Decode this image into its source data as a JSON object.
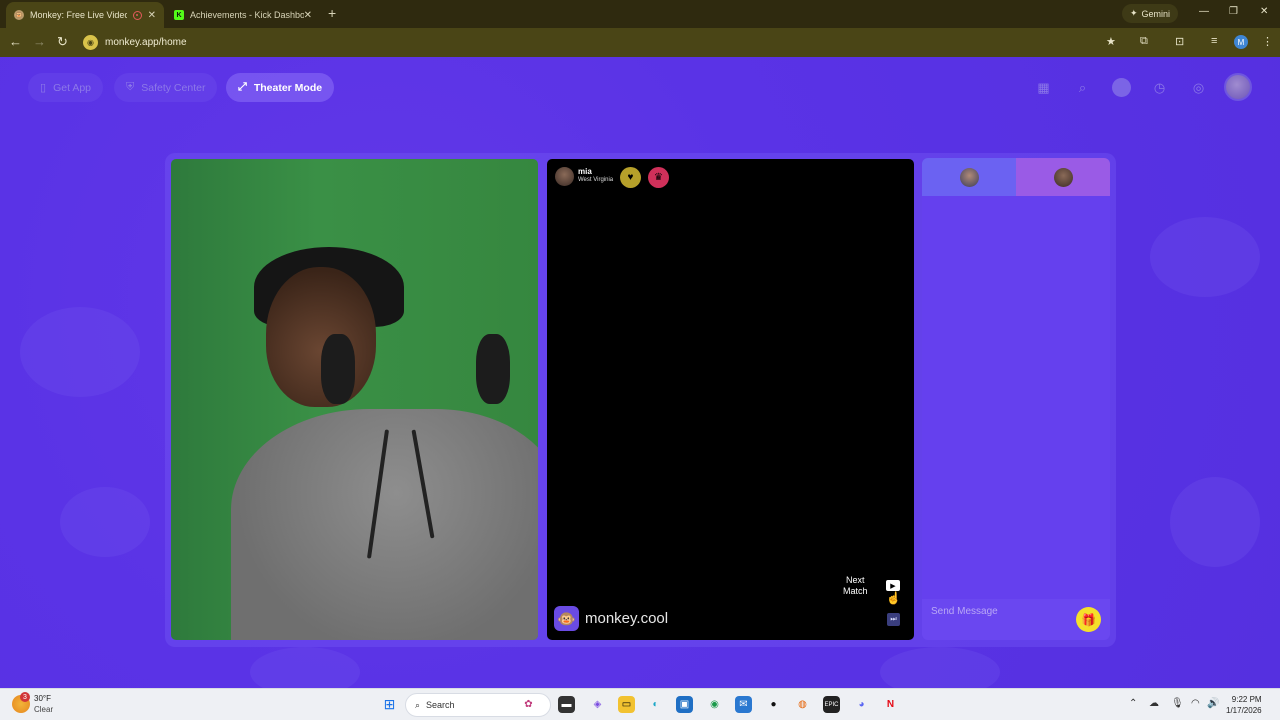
{
  "browser": {
    "tabs": [
      {
        "title": "Monkey: Free Live Video Ch",
        "active": true
      },
      {
        "title": "Achievements - Kick Dashboard",
        "active": false
      }
    ],
    "gemini_label": "Gemini",
    "url": "monkey.app/home",
    "profile_initial": "M"
  },
  "topbar": {
    "get_app": "Get App",
    "safety_center": "Safety Center",
    "theater_mode": "Theater Mode"
  },
  "remote_user": {
    "name": "mia",
    "location": "West Virginia"
  },
  "video": {
    "next_match_line1": "Next",
    "next_match_line2": "Match",
    "brand": "monkey.cool"
  },
  "chat": {
    "placeholder": "Send Message"
  },
  "taskbar": {
    "weather_temp": "30°F",
    "weather_cond": "Clear",
    "weather_badge": "3",
    "search_label": "Search",
    "time": "9:22 PM",
    "date": "1/17/2026"
  },
  "colors": {
    "page_bg": "#5a33e6",
    "gift": "#f5e02a",
    "chrome": "#4a4516"
  }
}
